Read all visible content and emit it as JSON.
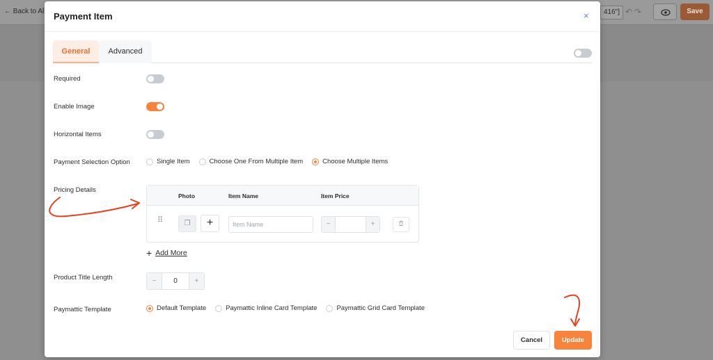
{
  "background": {
    "back_link": "Back to All",
    "code_fragment": "416\"]",
    "save_label": "Save"
  },
  "modal": {
    "title": "Payment Item",
    "close_glyph": "×"
  },
  "tabs": [
    {
      "label": "General",
      "active": true
    },
    {
      "label": "Advanced",
      "active": false
    }
  ],
  "fields": {
    "required": {
      "label": "Required",
      "on": false
    },
    "enable_image": {
      "label": "Enable Image",
      "on": true
    },
    "horizontal_items": {
      "label": "Horizontal Items",
      "on": false
    },
    "payment_selection": {
      "label": "Payment Selection Option",
      "options": [
        "Single Item",
        "Choose One From Multiple Item",
        "Choose Multiple Items"
      ],
      "selected": "Choose Multiple Items"
    },
    "pricing": {
      "label": "Pricing Details",
      "columns": [
        "Photo",
        "Item Name",
        "Item Price"
      ],
      "item_name_placeholder": "Item Name",
      "price_value": "",
      "add_more": "Add More"
    },
    "title_length": {
      "label": "Product Title Length",
      "value": "0"
    },
    "template": {
      "label": "Paymattic Template",
      "options": [
        "Default Template",
        "Paymattic Inline Card Template",
        "Paymattic Grid Card Template"
      ],
      "selected": "Default Template"
    }
  },
  "footer": {
    "cancel": "Cancel",
    "update": "Update"
  },
  "colors": {
    "accent": "#f7843a",
    "annotation": "#e8401c"
  }
}
